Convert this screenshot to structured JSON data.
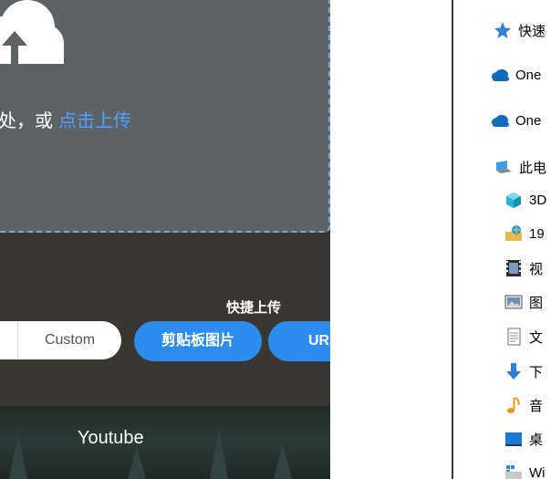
{
  "upload": {
    "drop_text": "处，或",
    "click_link": "点击上传"
  },
  "controls": {
    "quick_title": "快捷上传",
    "custom_label": "Custom",
    "clipboard_label": "剪贴板图片",
    "url_label": "UR"
  },
  "bottom": {
    "youtube_label": "Youtube"
  },
  "explorer": {
    "items": [
      {
        "label": "快速",
        "icon": "star-icon"
      },
      {
        "label": "One",
        "icon": "onedrive-cloud-icon"
      },
      {
        "label": "One",
        "icon": "onedrive-cloud-icon"
      },
      {
        "label": "此电",
        "icon": "this-pc-icon"
      },
      {
        "label": "3D",
        "icon": "3d-objects-icon"
      },
      {
        "label": "19",
        "icon": "network-folder-icon"
      },
      {
        "label": "视",
        "icon": "video-folder-icon"
      },
      {
        "label": "图",
        "icon": "pictures-folder-icon"
      },
      {
        "label": "文",
        "icon": "documents-folder-icon"
      },
      {
        "label": "下",
        "icon": "downloads-icon"
      },
      {
        "label": "音",
        "icon": "music-icon"
      },
      {
        "label": "桌",
        "icon": "desktop-icon"
      },
      {
        "label": "Wi",
        "icon": "windows-drive-icon"
      }
    ]
  },
  "colors": {
    "accent_blue": "#2d8cf0",
    "link_blue": "#4da3ff",
    "dropzone_bg": "#5d6267",
    "controls_bg": "#3a3632"
  }
}
